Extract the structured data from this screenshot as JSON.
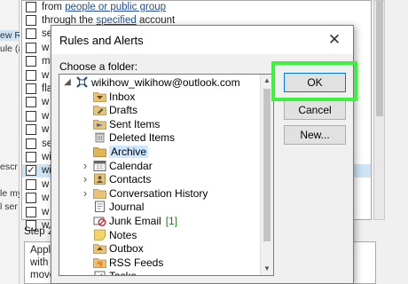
{
  "background": {
    "left_fragments": [
      {
        "text": "ew R",
        "highlight": true
      },
      {
        "text": "ule (a",
        "highlight": false
      },
      {
        "text": "",
        "highlight": false
      },
      {
        "text": "escr",
        "highlight": false
      },
      {
        "text": "le my",
        "highlight": false
      },
      {
        "text": "l ser",
        "highlight": false
      }
    ],
    "conditions": [
      {
        "checked": false,
        "text": "from ",
        "link": "people or public group",
        "after": ""
      },
      {
        "checked": false,
        "text": "through the ",
        "link": "specified",
        "after": " account"
      },
      {
        "checked": false,
        "text": "se",
        "link": "",
        "after": ""
      },
      {
        "checked": false,
        "text": "w",
        "link": "",
        "after": ""
      },
      {
        "checked": false,
        "text": "m",
        "link": "",
        "after": ""
      },
      {
        "checked": false,
        "text": "w",
        "link": "",
        "after": ""
      },
      {
        "checked": false,
        "text": "fla",
        "link": "",
        "after": ""
      },
      {
        "checked": false,
        "text": "w",
        "link": "",
        "after": ""
      },
      {
        "checked": false,
        "text": "w",
        "link": "",
        "after": ""
      },
      {
        "checked": false,
        "text": "w",
        "link": "",
        "after": ""
      },
      {
        "checked": false,
        "text": "se",
        "link": "",
        "after": ""
      },
      {
        "checked": false,
        "text": "wi",
        "link": "",
        "after": ""
      },
      {
        "checked": true,
        "text": "wi",
        "link": "",
        "after": ""
      },
      {
        "checked": false,
        "text": "w",
        "link": "",
        "after": ""
      },
      {
        "checked": false,
        "text": "w",
        "link": "",
        "after": ""
      },
      {
        "checked": false,
        "text": "w",
        "link": "",
        "after": ""
      },
      {
        "checked": false,
        "text": "w",
        "link": "",
        "after": ""
      }
    ],
    "step_label": "Step 2",
    "step_lines": [
      "Appl",
      "with",
      "move"
    ]
  },
  "dialog": {
    "title": "Rules and Alerts",
    "close_glyph": "✕",
    "folder_label": "Choose a folder:",
    "buttons": {
      "ok": "OK",
      "cancel": "Cancel",
      "new": "New..."
    },
    "highlight_color": "#3df23d",
    "folders": [
      {
        "name": "wikihow_wikihow@outlook.com",
        "icon": "account-icon",
        "level": 0,
        "expander": "collapse",
        "selected": false,
        "unread": ""
      },
      {
        "name": "Inbox",
        "icon": "inbox-icon",
        "level": 1,
        "expander": "",
        "selected": false,
        "unread": ""
      },
      {
        "name": "Drafts",
        "icon": "drafts-icon",
        "level": 1,
        "expander": "",
        "selected": false,
        "unread": ""
      },
      {
        "name": "Sent Items",
        "icon": "sent-items-icon",
        "level": 1,
        "expander": "",
        "selected": false,
        "unread": ""
      },
      {
        "name": "Deleted Items",
        "icon": "deleted-items-icon",
        "level": 1,
        "expander": "",
        "selected": false,
        "unread": ""
      },
      {
        "name": "Archive",
        "icon": "archive-icon",
        "level": 1,
        "expander": "",
        "selected": true,
        "unread": ""
      },
      {
        "name": "Calendar",
        "icon": "calendar-icon",
        "level": 1,
        "expander": "expand",
        "selected": false,
        "unread": ""
      },
      {
        "name": "Contacts",
        "icon": "contacts-icon",
        "level": 1,
        "expander": "expand",
        "selected": false,
        "unread": ""
      },
      {
        "name": "Conversation History",
        "icon": "folder-icon",
        "level": 1,
        "expander": "expand",
        "selected": false,
        "unread": ""
      },
      {
        "name": "Journal",
        "icon": "journal-icon",
        "level": 1,
        "expander": "",
        "selected": false,
        "unread": ""
      },
      {
        "name": "Junk Email",
        "icon": "junk-email-icon",
        "level": 1,
        "expander": "",
        "selected": false,
        "unread": "[1]"
      },
      {
        "name": "Notes",
        "icon": "notes-icon",
        "level": 1,
        "expander": "",
        "selected": false,
        "unread": ""
      },
      {
        "name": "Outbox",
        "icon": "outbox-icon",
        "level": 1,
        "expander": "",
        "selected": false,
        "unread": ""
      },
      {
        "name": "RSS Feeds",
        "icon": "rss-feeds-icon",
        "level": 1,
        "expander": "",
        "selected": false,
        "unread": ""
      },
      {
        "name": "Tasks",
        "icon": "tasks-icon",
        "level": 1,
        "expander": "",
        "selected": false,
        "unread": ""
      }
    ]
  }
}
